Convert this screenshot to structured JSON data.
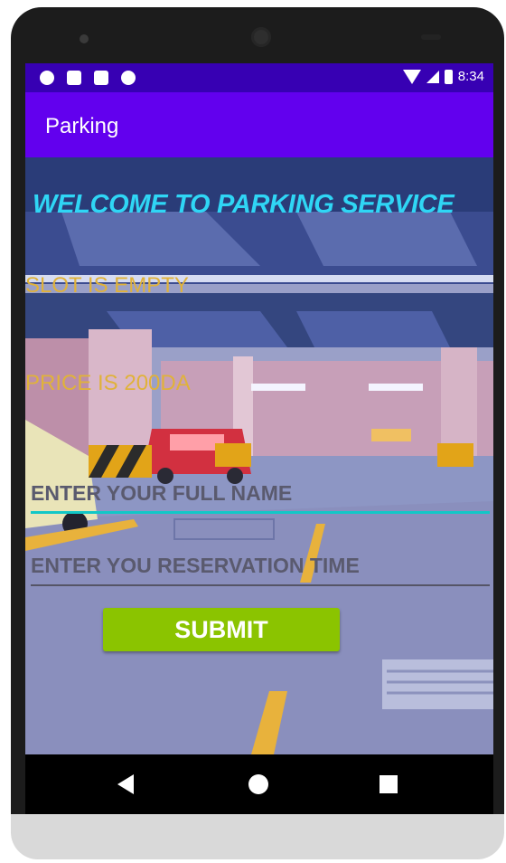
{
  "status_bar": {
    "time": "8:34",
    "left_icons": [
      "shield-icon",
      "image-icon",
      "sd-card-icon",
      "record-icon"
    ],
    "right_icons": [
      "wifi-icon",
      "signal-icon",
      "battery-icon"
    ]
  },
  "app_bar": {
    "title": "Parking"
  },
  "main": {
    "welcome_text": "WELCOME TO PARKING SERVICE",
    "slot_status": "SLOT IS EMPTY",
    "price_text": "PRICE IS 200DA",
    "name_field": {
      "placeholder": "ENTER YOUR FULL NAME",
      "value": ""
    },
    "time_field": {
      "placeholder": "ENTER YOU RESERVATION TIME",
      "value": ""
    },
    "submit_label": "SUBMIT"
  },
  "nav_bar": {
    "buttons": [
      "back-icon",
      "home-icon",
      "recents-icon"
    ]
  },
  "colors": {
    "status_bar": "#3700b3",
    "app_bar": "#6200ee",
    "welcome_text": "#2fd6f5",
    "info_text": "#e0b23a",
    "submit_button": "#8bc400",
    "active_underline": "#12c7c7"
  }
}
